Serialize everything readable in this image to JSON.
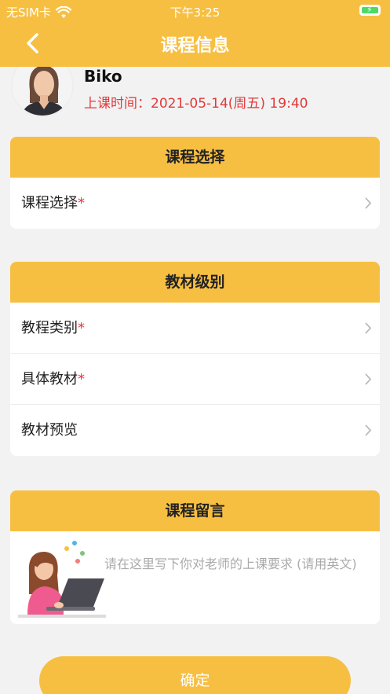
{
  "status_bar": {
    "carrier": "无SIM卡",
    "time": "下午3:25"
  },
  "header": {
    "title": "课程信息"
  },
  "teacher": {
    "name": "Biko",
    "class_time": "上课时间：2021-05-14(周五) 19:40"
  },
  "course_section": {
    "header": "课程选择",
    "rows": [
      {
        "label": "课程选择",
        "required": "*"
      }
    ]
  },
  "material_section": {
    "header": "教材级别",
    "rows": [
      {
        "label": "教程类别",
        "required": "*"
      },
      {
        "label": "具体教材",
        "required": "*"
      },
      {
        "label": "教材预览",
        "required": ""
      }
    ]
  },
  "message_section": {
    "header": "课程留言",
    "placeholder": "请在这里写下你对老师的上课要求 (请用英文)"
  },
  "confirm_button": "确定",
  "colors": {
    "accent": "#f7bf42",
    "danger": "#e23a3a",
    "background": "#f2f2f2"
  }
}
